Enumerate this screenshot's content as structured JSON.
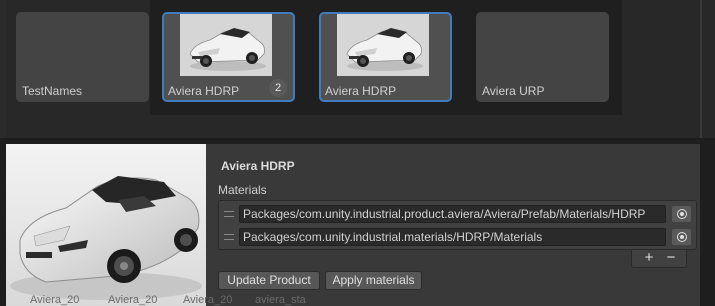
{
  "assets": [
    {
      "label": "TestNames"
    },
    {
      "label": "Aviera HDRP",
      "badge": "2",
      "selected": true
    },
    {
      "label": "Aviera HDRP",
      "selected": true
    },
    {
      "label": "Aviera URP"
    }
  ],
  "inspector": {
    "title": "Aviera HDRP",
    "section_label": "Materials",
    "materials": [
      "Packages/com.unity.industrial.product.aviera/Aviera/Prefab/Materials/HDRP",
      "Packages/com.unity.industrial.materials/HDRP/Materials"
    ],
    "add_label": "+",
    "remove_label": "−",
    "update_button": "Update Product",
    "apply_button": "Apply materials"
  },
  "background_labels": [
    "Aviera_20",
    "Aviera_20",
    "Aviera_20",
    "aviera_sta"
  ],
  "colors": {
    "selection": "#3f7dbf",
    "panel": "#393939",
    "card": "#444444"
  }
}
